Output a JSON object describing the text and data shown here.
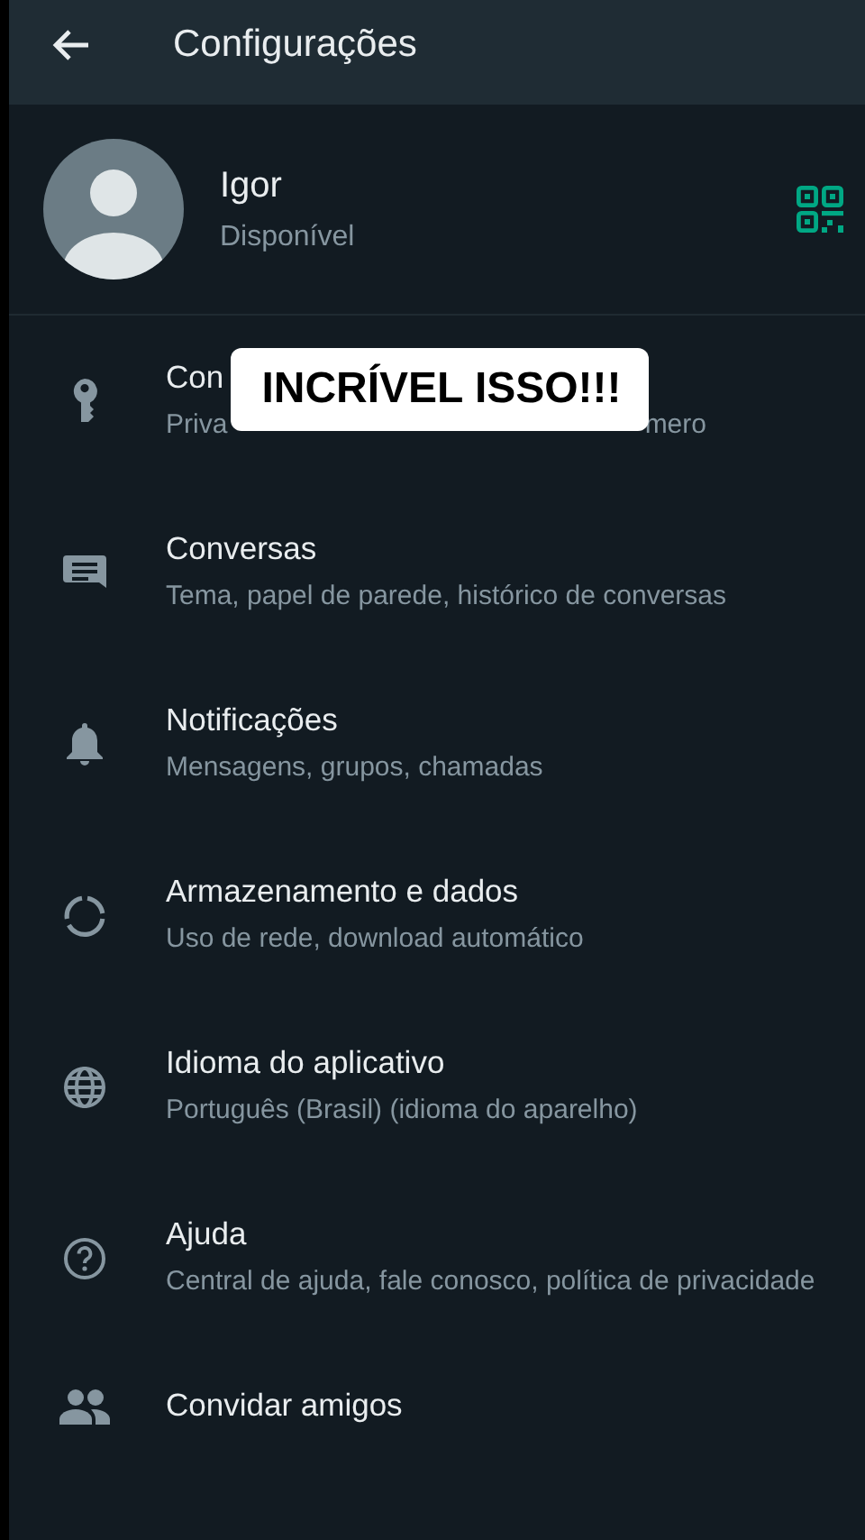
{
  "header": {
    "title": "Configurações"
  },
  "profile": {
    "name": "Igor",
    "status": "Disponível"
  },
  "settings": [
    {
      "kind": "key",
      "title": "Con",
      "subtitle_parts": [
        "Priva",
        "mero"
      ]
    },
    {
      "kind": "chat",
      "title": "Conversas",
      "subtitle": "Tema, papel de parede, histórico de conversas"
    },
    {
      "kind": "bell",
      "title": "Notificações",
      "subtitle": "Mensagens, grupos, chamadas"
    },
    {
      "kind": "data",
      "title": "Armazenamento e dados",
      "subtitle": "Uso de rede, download automático"
    },
    {
      "kind": "globe",
      "title": "Idioma do aplicativo",
      "subtitle": "Português (Brasil) (idioma do aparelho)"
    },
    {
      "kind": "help",
      "title": "Ajuda",
      "subtitle": "Central de ajuda, fale conosco, política de privacidade"
    },
    {
      "kind": "people",
      "title": "Convidar amigos"
    }
  ],
  "caption": {
    "text": "INCRÍVEL ISSO!!!"
  }
}
